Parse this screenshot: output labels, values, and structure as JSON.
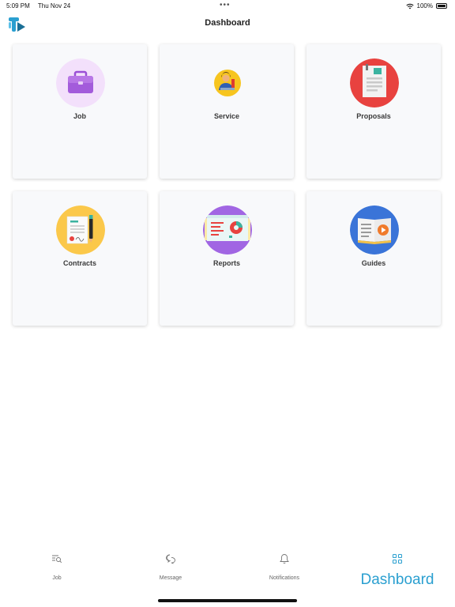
{
  "status_bar": {
    "time": "5:09 PM",
    "date": "Thu Nov 24",
    "battery": "100%",
    "center_dots": "•••"
  },
  "header": {
    "title": "Dashboard",
    "logo_icon": "app-logo-icon"
  },
  "cards": [
    {
      "label": "Job",
      "icon": "briefcase-icon"
    },
    {
      "label": "Service",
      "icon": "service-person-icon"
    },
    {
      "label": "Proposals",
      "icon": "proposal-document-icon"
    },
    {
      "label": "Contracts",
      "icon": "contract-pen-icon"
    },
    {
      "label": "Reports",
      "icon": "report-chart-icon"
    },
    {
      "label": "Guides",
      "icon": "guide-book-video-icon"
    }
  ],
  "tabs": [
    {
      "label": "Job",
      "icon": "job-search-icon"
    },
    {
      "label": "Message",
      "icon": "chat-bubbles-icon"
    },
    {
      "label": "Notifications",
      "icon": "bell-icon"
    },
    {
      "label": "Dashboard",
      "icon": "grid-icon",
      "active": true
    }
  ],
  "colors": {
    "accent": "#2a9fd0",
    "card_bg": "#f8f9fb"
  }
}
